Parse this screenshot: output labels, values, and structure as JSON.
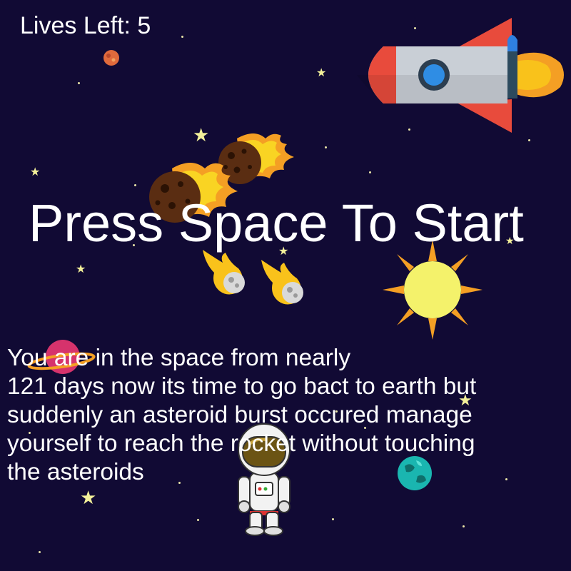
{
  "hud": {
    "lives_label": "Lives Left: 5"
  },
  "title": "Press Space To Start",
  "story": {
    "lines": [
      "You are  in the space from nearly",
      "121 days now its time to go bact to earth but",
      "suddenly an asteroid burst occured manage",
      "yourself to reach the rocket without touching",
      "the asteroids"
    ]
  },
  "colors": {
    "background": "#110a34",
    "text": "#ffffff",
    "star": "#f4f19a",
    "rocket_body": "#c9cfd6",
    "rocket_fin": "#e84b3c",
    "flame": "#f9c21b",
    "sun": "#f4f26b",
    "sun_rays": "#f49f24"
  },
  "icons": [
    "rocket-icon",
    "asteroid-icon",
    "meteor-icon",
    "sun-icon",
    "planet-icon",
    "astronaut-icon",
    "star-icon"
  ]
}
